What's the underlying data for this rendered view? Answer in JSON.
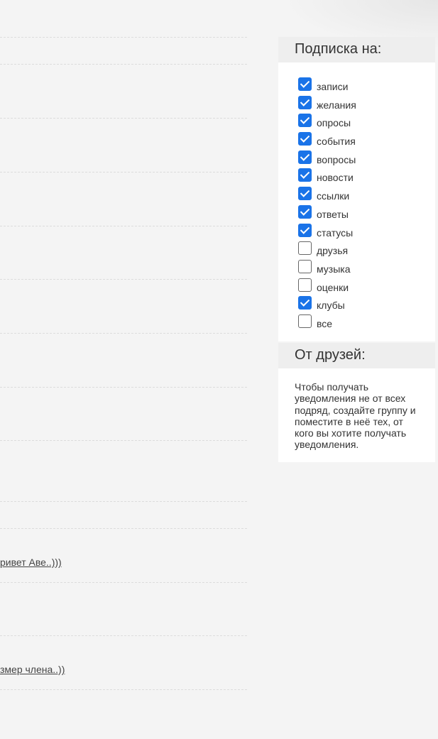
{
  "feed": {
    "links": [
      "ривет Аве..)))",
      "змер члена..))"
    ]
  },
  "subscription": {
    "title": "Подписка на:",
    "options": [
      {
        "label": "записи",
        "checked": true
      },
      {
        "label": "желания",
        "checked": true
      },
      {
        "label": "опросы",
        "checked": true
      },
      {
        "label": "события",
        "checked": true
      },
      {
        "label": "вопросы",
        "checked": true
      },
      {
        "label": "новости",
        "checked": true
      },
      {
        "label": "ссылки",
        "checked": true
      },
      {
        "label": "ответы",
        "checked": true
      },
      {
        "label": "статусы",
        "checked": true
      },
      {
        "label": "друзья",
        "checked": false
      },
      {
        "label": "музыка",
        "checked": false
      },
      {
        "label": "оценки",
        "checked": false
      },
      {
        "label": "клубы",
        "checked": true
      },
      {
        "label": "все",
        "checked": false
      }
    ]
  },
  "friends": {
    "title": "От друзей:",
    "text": "Чтобы получать уведомления не от всех подряд, создайте группу и поместите в неё тех, от кого вы хотите получать уведомления."
  },
  "colors": {
    "background": "#f4f4f4",
    "checkbox_accent": "#1a73e8",
    "panel_header": "#eeeeee"
  }
}
